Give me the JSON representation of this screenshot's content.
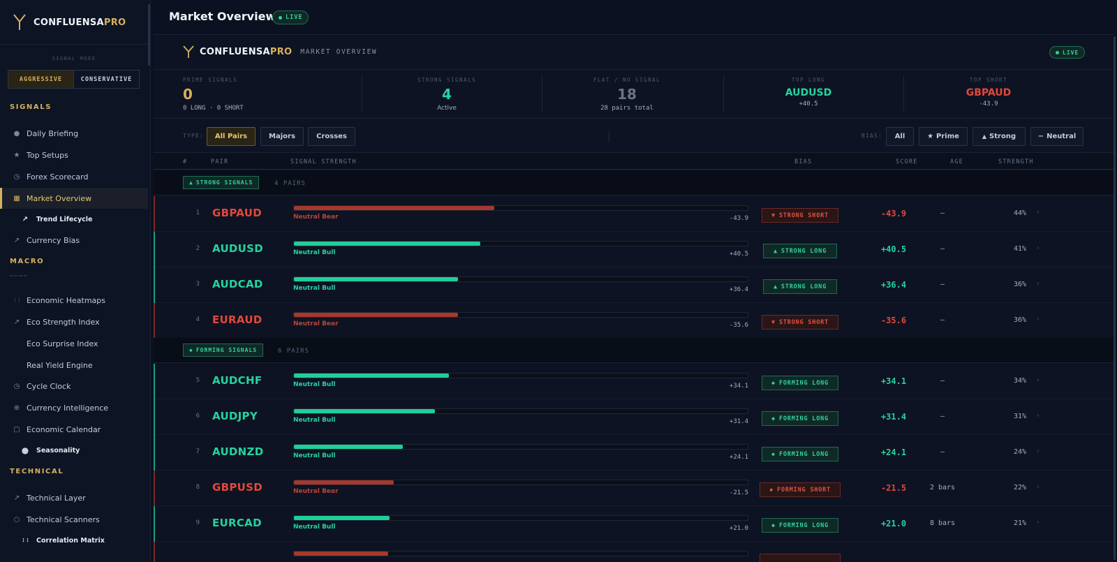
{
  "app": {
    "brand_main": "CONFLUENSA",
    "brand_accent": "PRO",
    "colors": {
      "gold": "#d7b15e",
      "green": "#25d3a0",
      "red": "#e2483a",
      "bg": "#0b1120"
    }
  },
  "sidebar": {
    "mode_label": "SIGNAL MODE",
    "mode_options": [
      "AGGRESSIVE",
      "CONSERVATIVE"
    ],
    "mode_selected": "AGGRESSIVE",
    "sections": [
      {
        "title": "SIGNALS",
        "items": [
          {
            "label": "Daily Briefing",
            "icon": "person-icon"
          },
          {
            "label": "Top Setups",
            "icon": "star-icon"
          },
          {
            "label": "Forex Scorecard",
            "icon": "clock-icon"
          },
          {
            "label": "Market Overview",
            "icon": "grid-icon",
            "active": true
          },
          {
            "label": "Trend Lifecycle",
            "icon": "trend-icon",
            "sub": true
          },
          {
            "label": "Currency Bias",
            "icon": "trend-icon"
          }
        ]
      },
      {
        "title": "MACRO",
        "items": [
          {
            "label": "Economic Heatmaps",
            "icon": "dots-grid-icon"
          },
          {
            "label": "Eco Strength Index",
            "icon": "trend-icon"
          },
          {
            "label": "Eco Surprise Index",
            "icon": ""
          },
          {
            "label": "Real Yield Engine",
            "icon": ""
          },
          {
            "label": "Cycle Clock",
            "icon": "clock-icon"
          },
          {
            "label": "Currency Intelligence",
            "icon": "plus-circle-icon"
          },
          {
            "label": "Economic Calendar",
            "icon": "calendar-icon"
          },
          {
            "label": "Seasonality",
            "icon": "circle-icon",
            "sub": true
          }
        ]
      },
      {
        "title": "TECHNICAL",
        "items": [
          {
            "label": "Technical Layer",
            "icon": "trend-icon"
          },
          {
            "label": "Technical Scanners",
            "icon": "circle-outline-icon"
          },
          {
            "label": "Correlation Matrix",
            "icon": "dots-grid-icon",
            "sub": true
          }
        ]
      }
    ]
  },
  "header": {
    "title": "Market Overview",
    "live": "LIVE"
  },
  "panel": {
    "subtitle": "MARKET OVERVIEW",
    "live": "LIVE",
    "stats": [
      {
        "label": "PRIME SIGNALS",
        "value": "0",
        "sub": "0 LONG · 0 SHORT"
      },
      {
        "label": "STRONG SIGNALS",
        "value": "4",
        "sub": "Active"
      },
      {
        "label": "FLAT / NO SIGNAL",
        "value": "18",
        "sub": "28 pairs total"
      },
      {
        "label": "TOP LONG",
        "value": "AUDUSD",
        "sub": "+40.5"
      },
      {
        "label": "TOP SHORT",
        "value": "GBPAUD",
        "sub": "-43.9"
      }
    ],
    "type_filter": {
      "label": "TYPE:",
      "options": [
        "All Pairs",
        "Majors",
        "Crosses"
      ],
      "selected": "All Pairs"
    },
    "bias_filter": {
      "label": "BIAS:",
      "options": [
        "All",
        "Prime",
        "Strong",
        "Neutral"
      ],
      "selected": "All"
    },
    "columns": [
      "#",
      "PAIR",
      "SIGNAL STRENGTH",
      "BIAS",
      "SCORE",
      "AGE",
      "STRENGTH"
    ],
    "groups": [
      {
        "label": "STRONG SIGNALS",
        "count": "4 PAIRS",
        "rows": [
          {
            "n": "1",
            "pair": "GBPAUD",
            "dir": "short",
            "bias_label": "Neutral Bear",
            "strength_pct": 44,
            "bar_value": "-43.9",
            "pill": "STRONG SHORT",
            "score": "-43.9",
            "age": "—",
            "strength": "44%"
          },
          {
            "n": "2",
            "pair": "AUDUSD",
            "dir": "long",
            "bias_label": "Neutral Bull",
            "strength_pct": 41,
            "bar_value": "+40.5",
            "pill": "STRONG LONG",
            "score": "+40.5",
            "age": "—",
            "strength": "41%"
          },
          {
            "n": "3",
            "pair": "AUDCAD",
            "dir": "long",
            "bias_label": "Neutral Bull",
            "strength_pct": 36,
            "bar_value": "+36.4",
            "pill": "STRONG LONG",
            "score": "+36.4",
            "age": "—",
            "strength": "36%"
          },
          {
            "n": "4",
            "pair": "EURAUD",
            "dir": "short",
            "bias_label": "Neutral Bear",
            "strength_pct": 36,
            "bar_value": "-35.6",
            "pill": "STRONG SHORT",
            "score": "-35.6",
            "age": "—",
            "strength": "36%"
          }
        ]
      },
      {
        "label": "FORMING SIGNALS",
        "count": "6 PAIRS",
        "rows": [
          {
            "n": "5",
            "pair": "AUDCHF",
            "dir": "long",
            "bias_label": "Neutral Bull",
            "strength_pct": 34,
            "bar_value": "+34.1",
            "pill": "FORMING LONG",
            "score": "+34.1",
            "age": "—",
            "strength": "34%"
          },
          {
            "n": "6",
            "pair": "AUDJPY",
            "dir": "long",
            "bias_label": "Neutral Bull",
            "strength_pct": 31,
            "bar_value": "+31.4",
            "pill": "FORMING LONG",
            "score": "+31.4",
            "age": "—",
            "strength": "31%"
          },
          {
            "n": "7",
            "pair": "AUDNZD",
            "dir": "long",
            "bias_label": "Neutral Bull",
            "strength_pct": 24,
            "bar_value": "+24.1",
            "pill": "FORMING LONG",
            "score": "+24.1",
            "age": "—",
            "strength": "24%"
          },
          {
            "n": "8",
            "pair": "GBPUSD",
            "dir": "short",
            "bias_label": "Neutral Bear",
            "strength_pct": 22,
            "bar_value": "-21.5",
            "pill": "FORMING SHORT",
            "score": "-21.5",
            "age": "2 bars",
            "strength": "22%"
          },
          {
            "n": "9",
            "pair": "EURCAD",
            "dir": "long",
            "bias_label": "Neutral Bull",
            "strength_pct": 21,
            "bar_value": "+21.0",
            "pill": "FORMING LONG",
            "score": "+21.0",
            "age": "8 bars",
            "strength": "21%"
          }
        ]
      }
    ]
  }
}
